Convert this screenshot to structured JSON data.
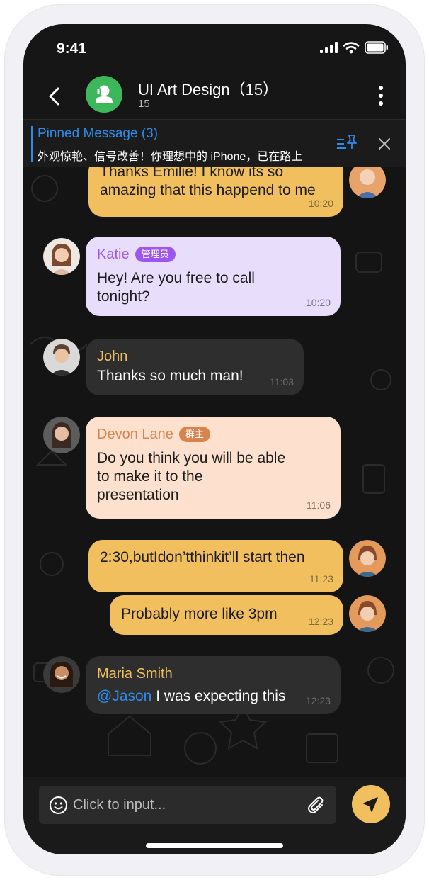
{
  "status_bar": {
    "time": "9:41",
    "signal_icon": "signal-icon",
    "wifi_icon": "wifi-icon",
    "battery_icon": "battery-icon"
  },
  "header": {
    "title": "UI Art Design（15）",
    "subtitle": "15",
    "back_icon": "chevron-left-icon",
    "avatar_icon": "group-avatar-icon",
    "more_icon": "more-vertical-icon"
  },
  "pinned": {
    "title": "Pinned Message (3)",
    "text": "外观惊艳、信号改善！你理想中的 iPhone，已在路上",
    "list_icon": "pinned-list-icon",
    "close_icon": "close-icon"
  },
  "messages": [
    {
      "type": "outgoing",
      "text": "Thanks Emilie! I know its so amazing that this happend to me",
      "time": "10:20"
    },
    {
      "type": "incoming",
      "sender": "Katie",
      "role": "管理员",
      "text": "Hey! Are you free to call tonight?",
      "time": "10:20"
    },
    {
      "type": "incoming",
      "sender": "John",
      "text": "Thanks so much man!",
      "time": "11:03"
    },
    {
      "type": "incoming",
      "sender": "Devon Lane",
      "role": "群主",
      "text": "Do you think you will be able to make it to the presentation",
      "time": "11:06"
    },
    {
      "type": "outgoing",
      "text": "2:30,butIdon’tthinkit’ll start then",
      "time": "11:23"
    },
    {
      "type": "outgoing",
      "text": "Probably more like 3pm",
      "time": "12:23"
    },
    {
      "type": "incoming",
      "sender": "Maria Smith",
      "mention": "@Jason",
      "text": " I was expecting this",
      "time": "12:23"
    }
  ],
  "input": {
    "placeholder": "Click to input...",
    "emoji_icon": "smile-icon",
    "attach_icon": "paperclip-icon",
    "send_icon": "send-icon"
  },
  "colors": {
    "outgoing": "#f2bf5e",
    "katie": "#e9ddfc",
    "incoming_dark": "#2e2e2e",
    "devon": "#fde0cd",
    "accent_blue": "#2e8be8",
    "admin_badge": "#9d57ef",
    "owner_badge": "#d9824b"
  }
}
